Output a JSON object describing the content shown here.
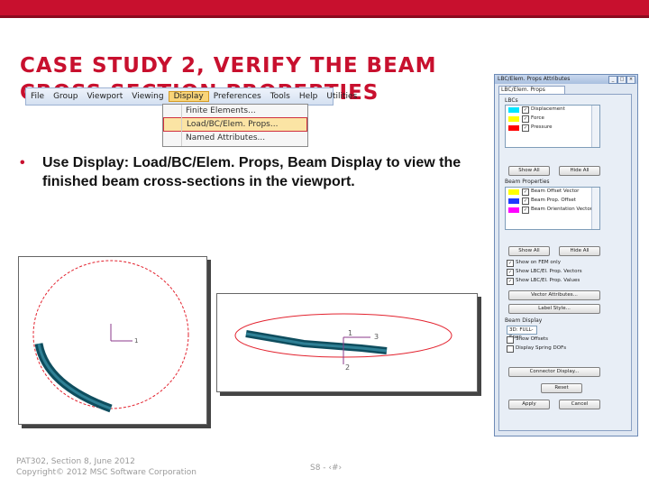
{
  "slide": {
    "title": "CASE STUDY 2, VERIFY THE BEAM CROSS SECTION PROPERTIES",
    "bullet_symbol": "•",
    "bullet_text": "Use Display: Load/BC/Elem. Props, Beam Display to view the finished beam cross-sections in the viewport.",
    "footer_line1": "PAT302, Section 8, June 2012",
    "footer_line2": "Copyright© 2012 MSC Software Corporation",
    "page_number": "S8 - ‹#›",
    "accent_color": "#c8102e"
  },
  "menu": {
    "items": [
      "File",
      "Group",
      "Viewport",
      "Viewing",
      "Display",
      "Preferences",
      "Tools",
      "Help",
      "Utilities"
    ],
    "active_item": "Display",
    "dropdown": [
      "Finite Elements...",
      "Load/BC/Elem. Props...",
      "Named Attributes..."
    ],
    "highlighted": "Load/BC/Elem. Props..."
  },
  "viewport1": {
    "triad_label": "1"
  },
  "viewport2": {
    "triad_labels": [
      "1",
      "3",
      "2"
    ]
  },
  "panel": {
    "title": "LBC/Elem. Props Attributes",
    "tab": "LBC/Elem. Props Attributes",
    "lbc_group_label": "LBCs",
    "lbc_items": [
      {
        "label": "Displacement",
        "color": "#00e5ff"
      },
      {
        "label": "Force",
        "color": "#ffff00"
      },
      {
        "label": "Pressure",
        "color": "#ff0000"
      }
    ],
    "show_all_label": "Show All",
    "hide_all_label": "Hide All",
    "beam_group_label": "Beam Properties",
    "beam_items": [
      {
        "label": "Beam Offset Vector",
        "color": "#ffff00"
      },
      {
        "label": "Beam Prop. Offset",
        "color": "#1e3cff"
      },
      {
        "label": "Beam Orientation Vector",
        "color": "#ff00ff"
      }
    ],
    "options": [
      "Show on FEM only",
      "Show LBC/El. Prop. Vectors",
      "Show LBC/El. Prop. Values"
    ],
    "vector_attributes_label": "Vector Attributes...",
    "label_style_label": "Label Style...",
    "beam_display_label": "Beam Display",
    "beam_display_value": "3D: FULL-Span",
    "options2": [
      "Show Offsets",
      "Display Spring DOFs"
    ],
    "connector_label": "Connector Display...",
    "reset_label": "Reset",
    "apply_label": "Apply",
    "cancel_label": "Cancel"
  }
}
